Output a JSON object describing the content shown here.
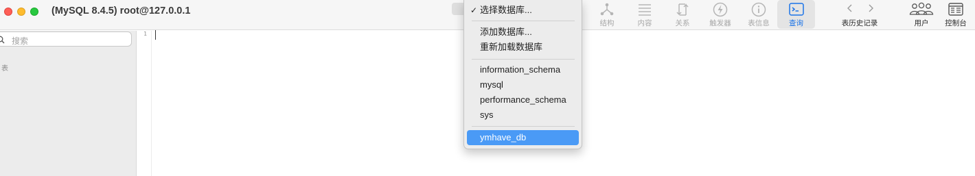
{
  "window": {
    "title": "(MySQL 8.4.5) root@127.0.0.1"
  },
  "toolbar": {
    "structure": "结构",
    "content": "内容",
    "relations": "关系",
    "triggers": "触发器",
    "table_info": "表信息",
    "query": "查询",
    "table_history": "表历史记录",
    "users": "用户",
    "console": "控制台",
    "active_tab": "查询",
    "accent_color": "#1a73e8"
  },
  "sidebar": {
    "search_placeholder": "搜索",
    "tables_header": "表"
  },
  "editor": {
    "line_numbers": [
      "1"
    ]
  },
  "database_menu": {
    "choose": "选择数据库...",
    "add": "添加数据库...",
    "reload": "重新加载数据库",
    "databases": [
      "information_schema",
      "mysql",
      "performance_schema",
      "sys"
    ],
    "selected": "ymhave_db",
    "selected_color": "#4a9af6"
  }
}
